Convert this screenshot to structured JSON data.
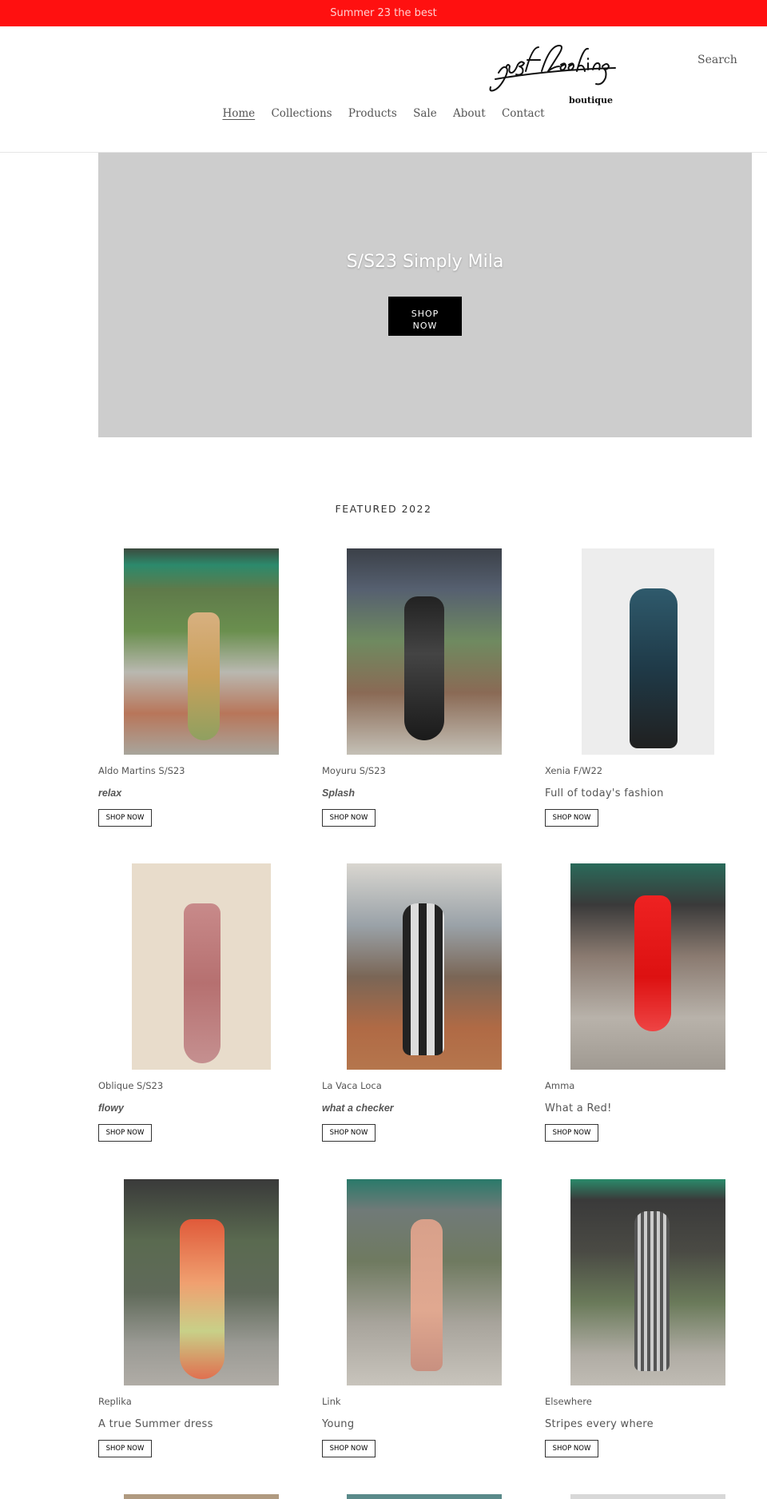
{
  "announcement": "Summer 23 the best",
  "header": {
    "logo_script": "just looking",
    "logo_sub": "boutique",
    "search_label": "Search",
    "nav": [
      {
        "label": "Home",
        "active": true
      },
      {
        "label": "Collections",
        "active": false
      },
      {
        "label": "Products",
        "active": false
      },
      {
        "label": "Sale",
        "active": false
      },
      {
        "label": "About",
        "active": false
      },
      {
        "label": "Contact",
        "active": false
      }
    ]
  },
  "hero": {
    "title": "S/S23 Simply Mila",
    "button_line1": "SHOP",
    "button_line2": "NOW"
  },
  "featured": {
    "title": "FEATURED 2022",
    "shop_label": "SHOP NOW",
    "products": [
      {
        "vendor": "Aldo Martins S/S23",
        "tagline": "relax",
        "style": "italic"
      },
      {
        "vendor": "Moyuru S/S23",
        "tagline": "Splash",
        "style": "italic"
      },
      {
        "vendor": "Xenia F/W22",
        "tagline": "Full of today's fashion",
        "style": "big"
      },
      {
        "vendor": "Oblique S/S23",
        "tagline": "flowy",
        "style": "italic"
      },
      {
        "vendor": "La Vaca Loca",
        "tagline": "what a checker",
        "style": "italic"
      },
      {
        "vendor": "Amma",
        "tagline": "What a Red!",
        "style": "big"
      },
      {
        "vendor": "Replika",
        "tagline": "A true Summer dress",
        "style": "big"
      },
      {
        "vendor": "Link",
        "tagline": "Young",
        "style": "big"
      },
      {
        "vendor": "Elsewhere",
        "tagline": "Stripes every where",
        "style": "big"
      }
    ]
  },
  "colors": {
    "announcement_bg": "#ff1010",
    "hero_bg": "#cdcdcd",
    "button_bg": "#000000"
  }
}
